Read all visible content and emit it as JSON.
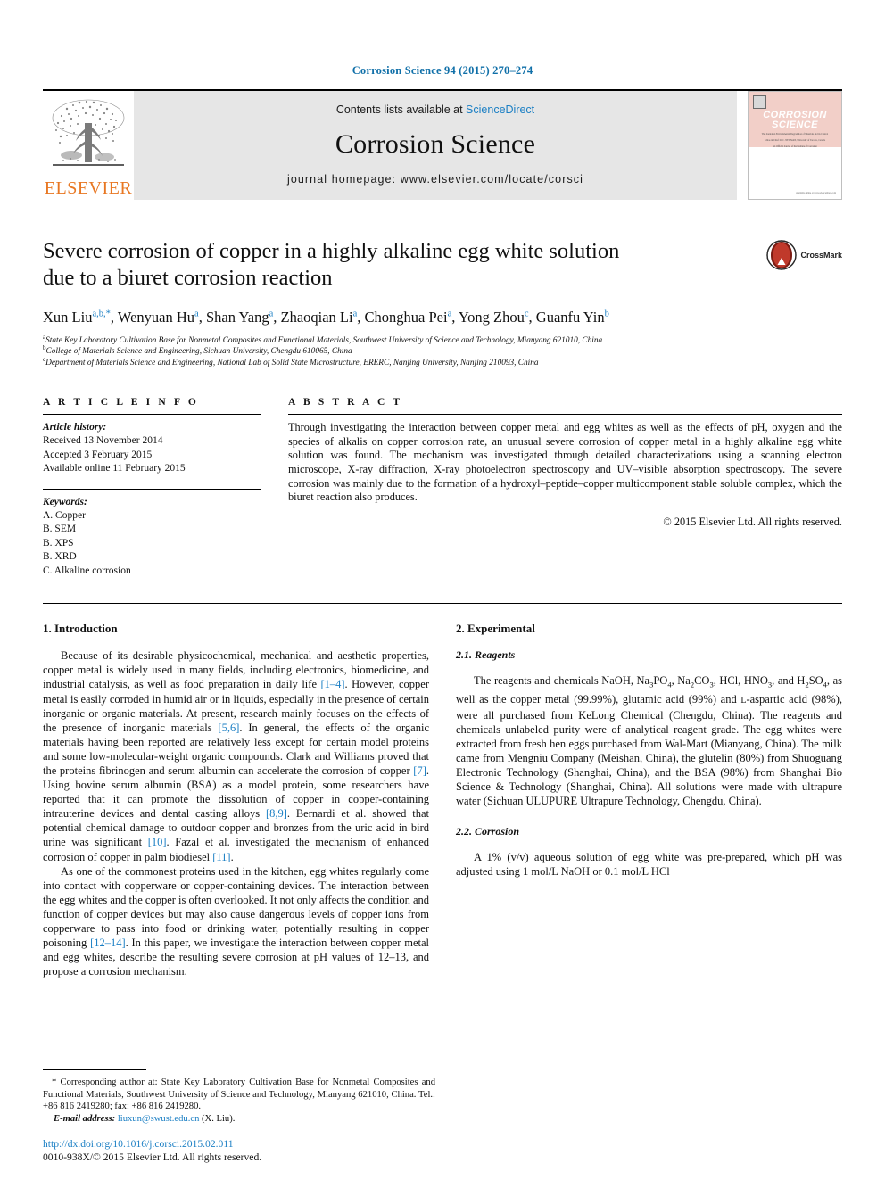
{
  "running_head": "Corrosion Science 94 (2015) 270–274",
  "journal_header": {
    "publisher": "ELSEVIER",
    "contents_prefix": "Contents lists available at ",
    "sciencedirect": "ScienceDirect",
    "journal_title": "Corrosion Science",
    "homepage": "journal homepage: www.elsevier.com/locate/corsci",
    "cover": {
      "line1": "CORROSION",
      "line2": "SCIENCE",
      "blurb": "The Journal on Environmental Degradation of Materials and its Control",
      "blurb2": "Editor-in-Chief: R. C. NEWMAN, University of Toronto, Canada",
      "blurb3": "An Official Journal of the Institute of Corrosion",
      "footer": "Available online at www.sciencedirect.com"
    }
  },
  "article": {
    "title_line1": "Severe corrosion of copper in a highly alkaline egg white solution",
    "title_line2": "due to a biuret corrosion reaction",
    "crossmark_label": "CrossMark",
    "authors": [
      {
        "name": "Xun Liu",
        "marks": "a,b,*"
      },
      {
        "name": "Wenyuan Hu",
        "marks": "a"
      },
      {
        "name": "Shan Yang",
        "marks": "a"
      },
      {
        "name": "Zhaoqian Li",
        "marks": "a"
      },
      {
        "name": "Chonghua Pei",
        "marks": "a"
      },
      {
        "name": "Yong Zhou",
        "marks": "c"
      },
      {
        "name": "Guanfu Yin",
        "marks": "b"
      }
    ],
    "affiliations": [
      {
        "mark": "a",
        "text": "State Key Laboratory Cultivation Base for Nonmetal Composites and Functional Materials, Southwest University of Science and Technology, Mianyang 621010, China"
      },
      {
        "mark": "b",
        "text": "College of Materials Science and Engineering, Sichuan University, Chengdu 610065, China"
      },
      {
        "mark": "c",
        "text": "Department of Materials Science and Engineering, National Lab of Solid State Microstructure, ERERC, Nanjing University, Nanjing 210093, China"
      }
    ]
  },
  "article_info": {
    "heading": "A R T I C L E   I N F O",
    "history_label": "Article history:",
    "received": "Received 13 November 2014",
    "accepted": "Accepted 3 February 2015",
    "available": "Available online 11 February 2015",
    "keywords_label": "Keywords:",
    "keywords": [
      "A. Copper",
      "B. SEM",
      "B. XPS",
      "B. XRD",
      "C. Alkaline corrosion"
    ]
  },
  "abstract": {
    "heading": "A B S T R A C T",
    "body": "Through investigating the interaction between copper metal and egg whites as well as the effects of pH, oxygen and the species of alkalis on copper corrosion rate, an unusual severe corrosion of copper metal in a highly alkaline egg white solution was found. The mechanism was investigated through detailed characterizations using a scanning electron microscope, X-ray diffraction, X-ray photoelectron spectroscopy and UV–visible absorption spectroscopy. The severe corrosion was mainly due to the formation of a hydroxyl–peptide–copper multicomponent stable soluble complex, which the biuret reaction also produces.",
    "copyright": "© 2015 Elsevier Ltd. All rights reserved."
  },
  "body": {
    "intro_heading": "1. Introduction",
    "intro_p1_a": "Because of its desirable physicochemical, mechanical and aesthetic properties, copper metal is widely used in many fields, including electronics, biomedicine, and industrial catalysis, as well as food preparation in daily life ",
    "intro_p1_ref1": "[1–4]",
    "intro_p1_b": ". However, copper metal is easily corroded in humid air or in liquids, especially in the presence of certain inorganic or organic materials. At present, research mainly focuses on the effects of the presence of inorganic materials ",
    "intro_p1_ref2": "[5,6]",
    "intro_p1_c": ". In general, the effects of the organic materials having been reported are relatively less except for certain model proteins and some low-molecular-weight organic compounds. Clark and Williams proved that the proteins fibrinogen and serum albumin can accelerate the corrosion of copper ",
    "intro_p1_ref3": "[7]",
    "intro_p1_d": ". Using bovine serum albumin (BSA) as a model protein, some researchers have reported that it can promote the dissolution of copper in copper-containing intrauterine devices and dental casting alloys ",
    "intro_p1_ref4": "[8,9]",
    "intro_p1_e": ". Bernardi et al. showed that potential chemical damage to outdoor copper and bronzes from the uric acid in bird urine was significant ",
    "intro_p1_ref5": "[10]",
    "intro_p1_f": ". Fazal et al. investigated the mechanism of enhanced corrosion of copper in palm biodiesel ",
    "intro_p1_ref6": "[11]",
    "intro_p1_g": ".",
    "intro_p2_a": "As one of the commonest proteins used in the kitchen, egg whites regularly come into contact with copperware or copper-containing devices. The interaction between the egg whites and the copper is often overlooked. It not only affects the condition and function of copper devices but may also cause dangerous levels of copper ions from copperware to pass into food or drinking water, potentially resulting in copper poisoning ",
    "intro_p2_ref1": "[12–14]",
    "intro_p2_b": ". In this paper, we investigate the interaction between copper metal and egg whites, describe the resulting severe corrosion at pH values of 12–13, and propose a corrosion mechanism.",
    "exp_heading": "2. Experimental",
    "reagents_heading": "2.1. Reagents",
    "reagents_p1_a": "The reagents and chemicals NaOH, Na",
    "reagents_p1_b": "PO",
    "reagents_p1_c": ", Na",
    "reagents_p1_d": "CO",
    "reagents_p1_e": ", HCl, HNO",
    "reagents_p1_f": ", and H",
    "reagents_p1_g": "SO",
    "reagents_p1_h": ", as well as the copper metal (99.99%), glutamic acid (99%) and ",
    "reagents_p1_i": "L",
    "reagents_p1_j": "-aspartic acid (98%), were all purchased from KeLong Chemical (Chengdu, China). The reagents and chemicals unlabeled purity were of analytical reagent grade. The egg whites were extracted from fresh hen eggs purchased from Wal-Mart (Mianyang, China). The milk came from Mengniu Company (Meishan, China), the glutelin (80%) from Shuoguang Electronic Technology (Shanghai, China), and the BSA (98%) from Shanghai Bio Science & Technology (Shanghai, China). All solutions were made with ultrapure water (Sichuan ULUPURE Ultrapure Technology, Chengdu, China).",
    "corrosion_heading": "2.2. Corrosion",
    "corrosion_p1": "A 1% (v/v) aqueous solution of egg white was pre-prepared, which pH was adjusted using 1 mol/L NaOH or 0.1 mol/L HCl"
  },
  "footnote": {
    "star": "*",
    "text": " Corresponding author at: State Key Laboratory Cultivation Base for Nonmetal Composites and Functional Materials, Southwest University of Science and Technology, Mianyang 621010, China. Tel.: +86 816 2419280; fax: +86 816 2419280.",
    "email_label": "E-mail address:",
    "email": "liuxun@swust.edu.cn",
    "email_suffix": " (X. Liu)."
  },
  "doi_block": {
    "doi": "http://dx.doi.org/10.1016/j.corsci.2015.02.011",
    "issn": "0010-938X/© 2015 Elsevier Ltd. All rights reserved."
  },
  "colors": {
    "link_blue": "#1b7fc4",
    "elsevier_orange": "#E87722",
    "header_grey": "#e6e6e6",
    "cover_pink": "#f2cfc8"
  }
}
